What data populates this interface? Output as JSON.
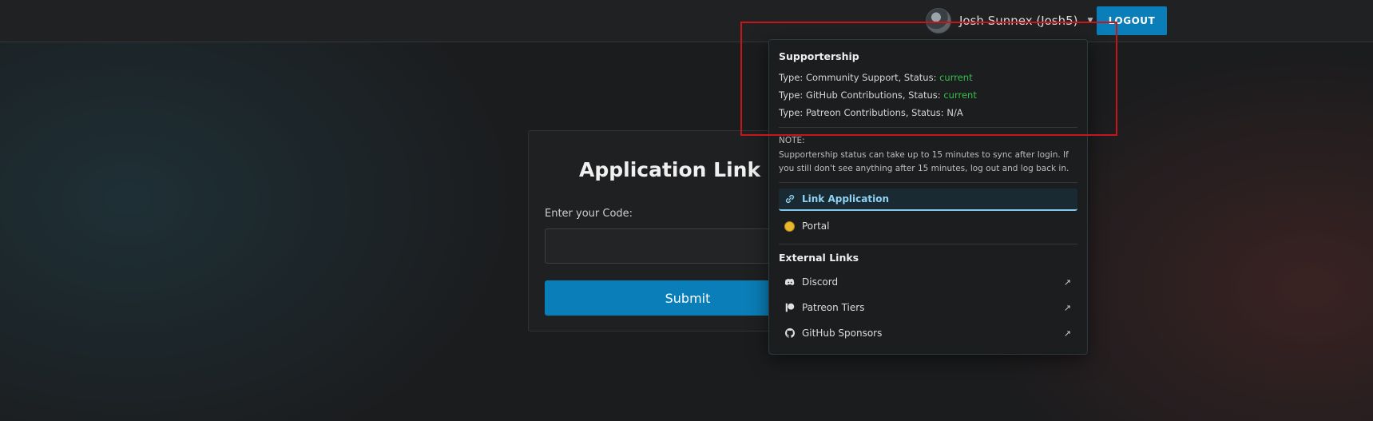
{
  "header": {
    "user_name": "Josh Sunnex (Josh5)",
    "logout_label": "LOGOUT"
  },
  "card": {
    "title": "Application Link Code",
    "code_label": "Enter your Code:",
    "code_value": "",
    "submit_label": "Submit"
  },
  "dropdown": {
    "supportership_heading": "Supportership",
    "statuses": [
      {
        "prefix": "Type: Community Support, Status: ",
        "status": "current"
      },
      {
        "prefix": "Type: GitHub Contributions, Status: ",
        "status": "current"
      },
      {
        "prefix": "Type: Patreon Contributions, Status: ",
        "status": "N/A"
      }
    ],
    "note_label": "NOTE:",
    "note_text": "Supportership status can take up to 15 minutes to sync after login. If you still don't see anything after 15 minutes, log out and log back in.",
    "menu": [
      {
        "label": "Link Application",
        "icon": "link-icon",
        "active": true
      },
      {
        "label": "Portal",
        "icon": "coin-icon",
        "active": false
      }
    ],
    "external_heading": "External Links",
    "external_links": [
      {
        "label": "Discord",
        "icon": "discord-icon"
      },
      {
        "label": "Patreon Tiers",
        "icon": "patreon-icon"
      },
      {
        "label": "GitHub Sponsors",
        "icon": "github-icon"
      }
    ],
    "external_arrow": "↗"
  },
  "colors": {
    "accent": "#0a7eb8",
    "status_current": "#35c04b",
    "highlight": "#c4161c"
  }
}
